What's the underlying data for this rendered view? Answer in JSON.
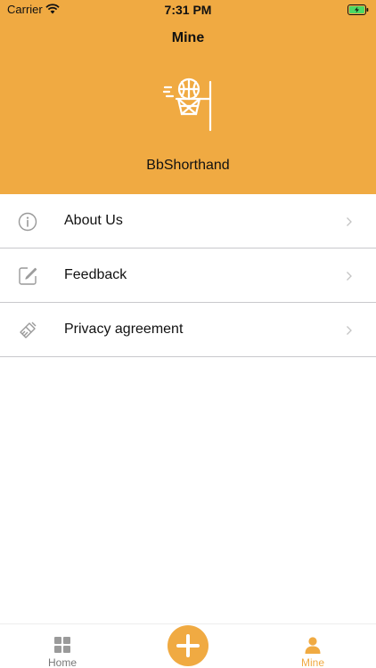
{
  "status_bar": {
    "carrier": "Carrier",
    "time": "7:31 PM"
  },
  "header": {
    "title": "Mine",
    "app_name": "BbShorthand",
    "logo_icon": "basketball-hoop-icon",
    "background_color": "#f0aa42"
  },
  "menu": {
    "items": [
      {
        "label": "About Us",
        "icon": "info-icon"
      },
      {
        "label": "Feedback",
        "icon": "edit-icon"
      },
      {
        "label": "Privacy agreement",
        "icon": "brush-icon"
      }
    ]
  },
  "tabbar": {
    "home_label": "Home",
    "mine_label": "Mine",
    "add_icon": "plus-icon",
    "active_tab": "Mine",
    "accent_color": "#f0aa42"
  }
}
